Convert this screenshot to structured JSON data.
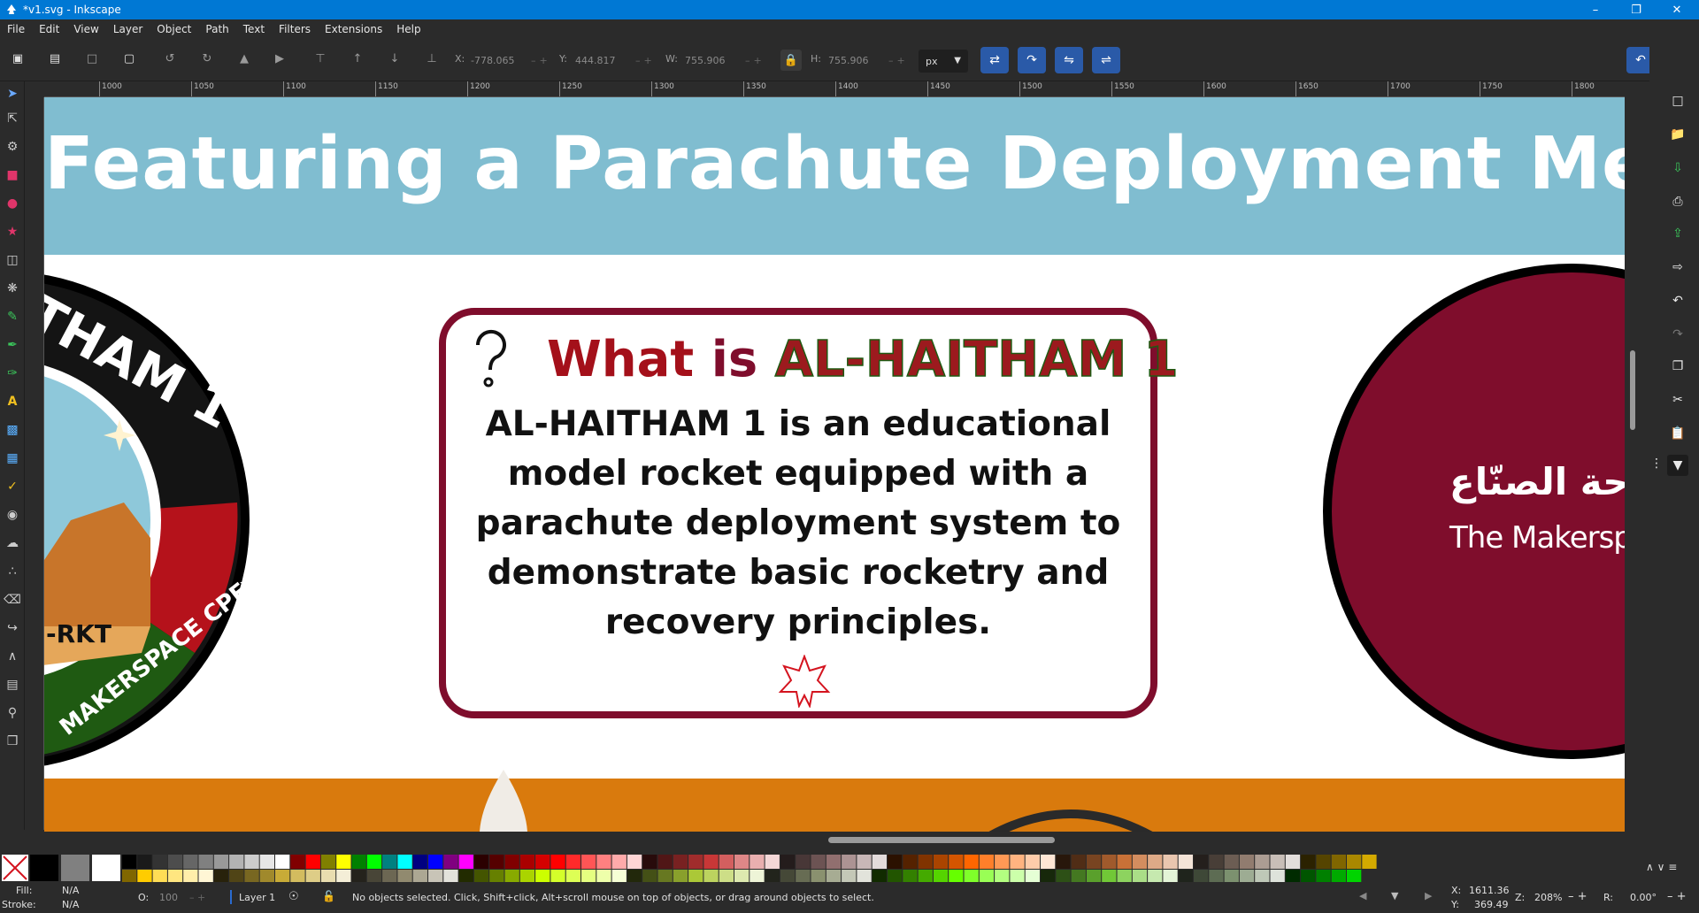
{
  "window": {
    "title": "*v1.svg - Inkscape"
  },
  "menu": [
    "File",
    "Edit",
    "View",
    "Layer",
    "Object",
    "Path",
    "Text",
    "Filters",
    "Extensions",
    "Help"
  ],
  "toolbar": {
    "x_label": "X:",
    "x_value": "-778.065",
    "y_label": "Y:",
    "y_value": "444.817",
    "w_label": "W:",
    "w_value": "755.906",
    "h_label": "H:",
    "h_value": "755.906",
    "unit": "px"
  },
  "ruler": {
    "ticks": [
      "1000",
      "1050",
      "1100",
      "1150",
      "1200",
      "1250",
      "1300",
      "1350",
      "1400",
      "1450",
      "1500",
      "1550",
      "1600",
      "1650",
      "1700",
      "1750",
      "1800"
    ]
  },
  "canvas": {
    "banner_title": "Featuring a Parachute Deployment Mechanism",
    "card": {
      "heading_what": "What",
      "heading_is": "is",
      "heading_name": "AL-HAITHAM 1",
      "body": "AL-HAITHAM 1 is an educational model rocket equipped with a parachute deployment system to demonstrate basic rocketry and recovery principles."
    },
    "left_badge": {
      "top_text": "THAM 1",
      "side_text": "-RKT",
      "bottom_text": "MAKERSPACE CPF"
    },
    "right_badge": {
      "arabic": "ساحة الصنّاع",
      "english": "The Makersp"
    }
  },
  "status": {
    "fill_label": "Fill:",
    "fill_value": "N/A",
    "stroke_label": "Stroke:",
    "stroke_value": "N/A",
    "opacity_label": "O:",
    "opacity_value": "100",
    "layer": "Layer 1",
    "message": "No objects selected. Click, Shift+click, Alt+scroll mouse on top of objects, or drag around objects to select.",
    "cursor_x_label": "X:",
    "cursor_x": "1611.36",
    "cursor_y_label": "Y:",
    "cursor_y": "369.49",
    "zoom_label": "Z:",
    "zoom": "208%",
    "rotate_label": "R:",
    "rotate": "0.00°"
  },
  "colors": {
    "accent": "#0078d4",
    "maroon": "#7f0d2c",
    "banner": "#80bdd0",
    "orange": "#d97a0d",
    "green": "#1f5a12",
    "red": "#b5121b"
  }
}
